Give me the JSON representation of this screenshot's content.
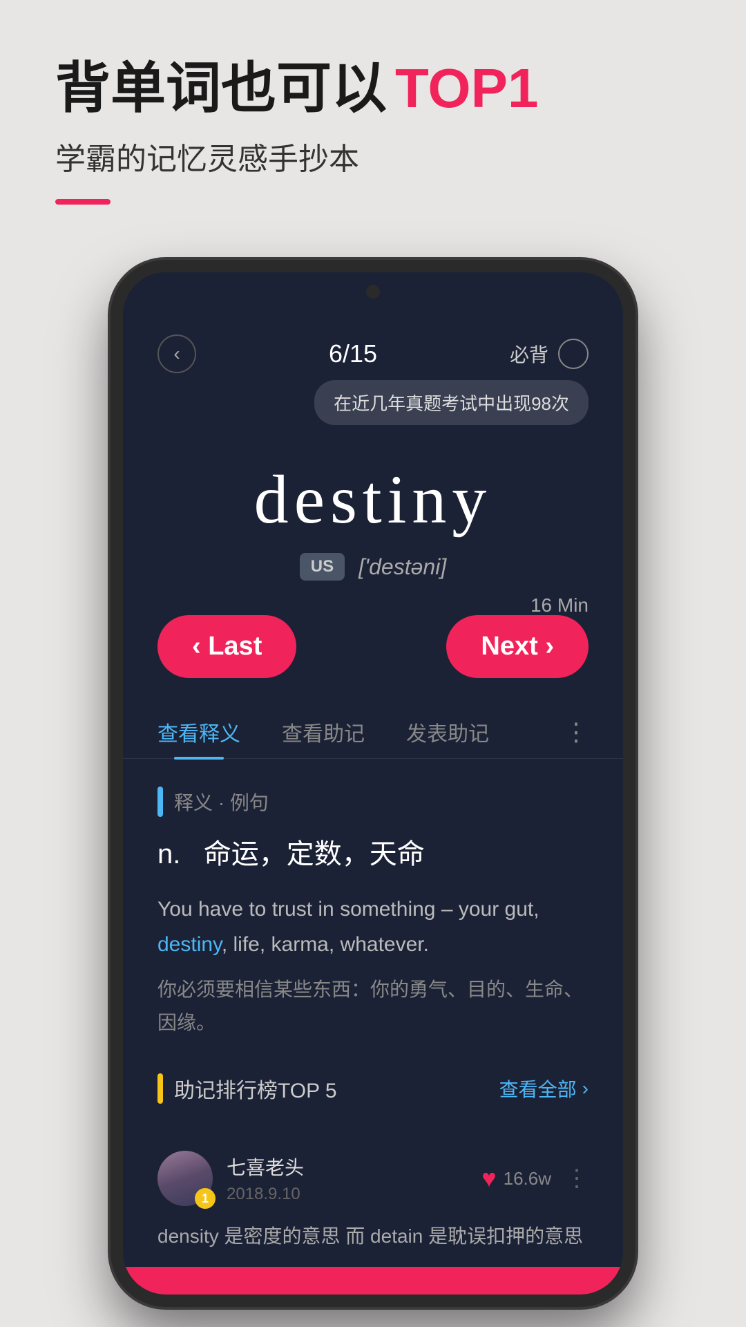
{
  "header": {
    "headline_prefix": "背单词也可以",
    "headline_suffix": "TOP1",
    "subtitle": "学霸的记忆灵感手抄本"
  },
  "nav": {
    "back_icon": "‹",
    "counter": "6/15",
    "must_label": "必背",
    "tooltip": "在近几年真题考试中出现98次"
  },
  "word": {
    "text": "destiny",
    "phonetic_region": "US",
    "phonetic": "['destəni]"
  },
  "timer": {
    "label": "16 Min"
  },
  "buttons": {
    "last_label": "‹ Last",
    "next_label": "Next ›"
  },
  "tabs": {
    "items": [
      {
        "label": "查看释义",
        "active": true
      },
      {
        "label": "查看助记",
        "active": false
      },
      {
        "label": "发表助记",
        "active": false
      }
    ],
    "more_icon": "⋮"
  },
  "definition": {
    "section_label": "释义 · 例句",
    "pos": "n.",
    "meanings": "命运，定数，天命",
    "example_en_before": "You have to trust in something – your gut, ",
    "example_en_word": "destiny",
    "example_en_after": ", life, karma, whatever.",
    "example_zh": "你必须要相信某些东西：你的勇气、目的、生命、因缘。"
  },
  "mnemonic": {
    "section_label": "助记排行榜TOP 5",
    "view_all_label": "查看全部",
    "user": {
      "name": "七喜老头",
      "date": "2018.9.10",
      "badge": "1",
      "like_count": "16.6w"
    },
    "mnemonic_text": "density 是密度的意思 而 detain 是耽误扣押的意思"
  }
}
